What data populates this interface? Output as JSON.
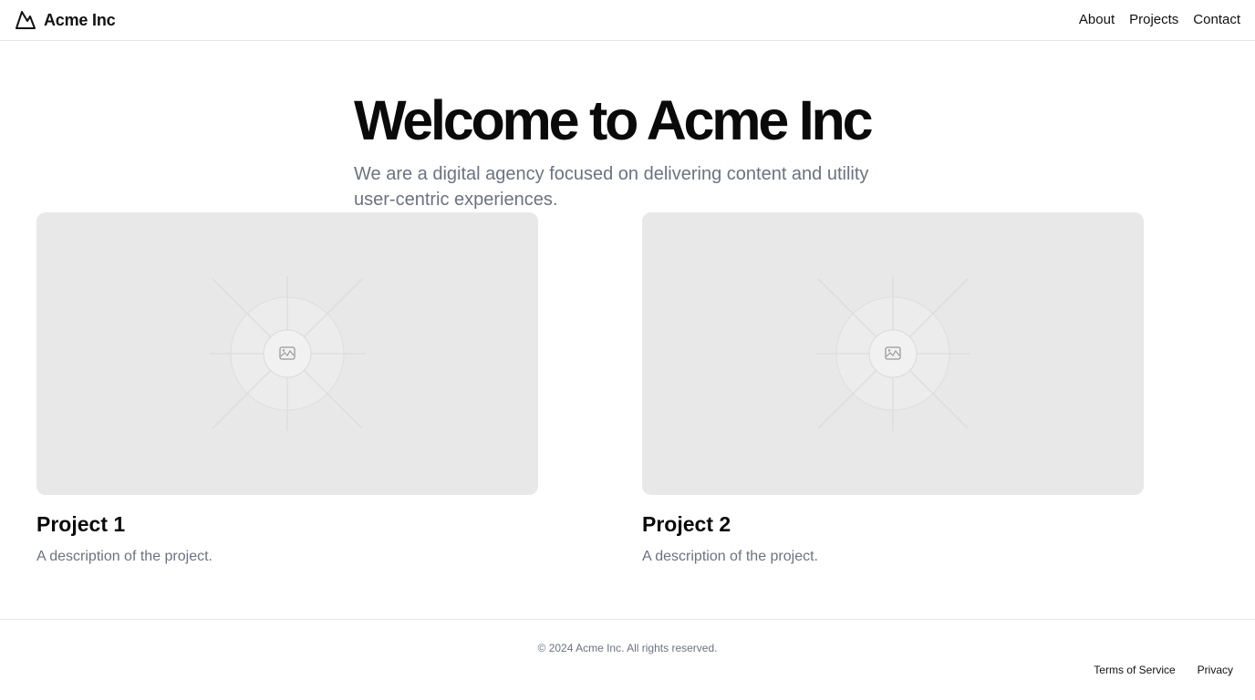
{
  "header": {
    "brand_name": "Acme Inc",
    "logo_icon": "mountain-icon",
    "nav": [
      "About",
      "Projects",
      "Contact"
    ]
  },
  "hero": {
    "title": "Welcome to Acme Inc",
    "subtitle": "We are a digital agency focused on delivering content and utility user-centric experiences."
  },
  "projects": [
    {
      "title": "Project 1",
      "description": "A description of the project.",
      "image_icon": "image-placeholder-icon"
    },
    {
      "title": "Project 2",
      "description": "A description of the project.",
      "image_icon": "image-placeholder-icon"
    }
  ],
  "footer": {
    "copyright": "© 2024 Acme Inc. All rights reserved.",
    "links": [
      "Terms of Service",
      "Privacy"
    ]
  },
  "colors": {
    "text": "#0a0a0a",
    "muted": "#6b7280",
    "placeholder_bg": "#e8e8e8",
    "border": "#e5e5e5"
  }
}
